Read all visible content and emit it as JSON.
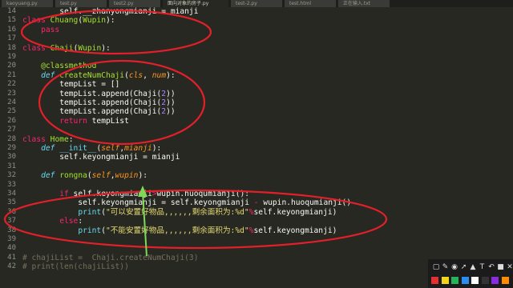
{
  "tabs": [
    {
      "label": "kaoyuang.py"
    },
    {
      "label": "test.py"
    },
    {
      "label": "test2.py"
    },
    {
      "label": "面向对象的房子.py"
    },
    {
      "label": "test-2.py"
    },
    {
      "label": "test.html"
    },
    {
      "label": "正在输入.txt"
    }
  ],
  "lines": [
    {
      "n": "14",
      "html": "        self.__zhanyongmianji = mianji"
    },
    {
      "n": "15",
      "html": "<span class='k'>class</span> <span class='f'>Chuang</span>(<span class='f'>Wupin</span>):"
    },
    {
      "n": "16",
      "html": "    <span class='k'>pass</span>"
    },
    {
      "n": "17",
      "html": ""
    },
    {
      "n": "18",
      "html": "<span class='k'>class</span> <span class='f'>Chaji</span>(<span class='f'>Wupin</span>):"
    },
    {
      "n": "19",
      "html": ""
    },
    {
      "n": "20",
      "html": "    <span class='f'>@classmethod</span>"
    },
    {
      "n": "21",
      "html": "    <span class='d'>def</span> <span class='f'>createNumChaji</span>(<span class='p'>cls</span>, <span class='p'>num</span>):"
    },
    {
      "n": "22",
      "html": "        tempList = []"
    },
    {
      "n": "23",
      "html": "        tempList.append(Chaji(<span class='n'>2</span>))"
    },
    {
      "n": "24",
      "html": "        tempList.append(Chaji(<span class='n'>2</span>))"
    },
    {
      "n": "25",
      "html": "        tempList.append(Chaji(<span class='n'>2</span>))"
    },
    {
      "n": "26",
      "html": "        <span class='k'>return</span> tempList"
    },
    {
      "n": "27",
      "html": ""
    },
    {
      "n": "28",
      "html": "<span class='k'>class</span> <span class='f'>Home</span>:"
    },
    {
      "n": "29",
      "html": "    <span class='d'>def</span> <span class='c'>__init__</span>(<span class='p'>self</span>,<span class='p'>mianji</span>):"
    },
    {
      "n": "30",
      "html": "        self.keyongmianji = mianji"
    },
    {
      "n": "31",
      "html": ""
    },
    {
      "n": "32",
      "html": "    <span class='d'>def</span> <span class='f'>rongna</span>(<span class='p'>self</span>,<span class='p'>wupin</span>):"
    },
    {
      "n": "33",
      "html": ""
    },
    {
      "n": "34",
      "html": "        <span class='k'>if</span> self.keyongmianji<span class='k'>&gt;</span>wupin.huoqumianji():"
    },
    {
      "n": "35",
      "html": "            self.keyongmianji = self.keyongmianji <span class='k'>-</span> wupin.huoqumianji()"
    },
    {
      "n": "36",
      "html": "            <span class='c'>print</span>(<span class='s'>\"可以安置好物品,,,,,,剩余面积为:%d\"</span><span class='k'>%</span>self.keyongmianji)"
    },
    {
      "n": "37",
      "html": "        <span class='k'>else</span>:"
    },
    {
      "n": "38",
      "html": "            <span class='c'>print</span>(<span class='s'>\"不能安置好物品,,,,,,剩余面积为:%d\"</span><span class='k'>%</span>self.keyongmianji)"
    },
    {
      "n": "39",
      "html": ""
    },
    {
      "n": "40",
      "html": ""
    },
    {
      "n": "41",
      "html": "<span class='cm'># chajiList =  Chaji.createNumChaji(3)</span>"
    },
    {
      "n": "42",
      "html": "<span class='cm'># print(len(chajiList))</span>"
    }
  ],
  "toolbar": {
    "buttons": [
      "▢",
      "✎",
      "◉",
      "➚",
      "▲",
      "T",
      "↶",
      "■",
      "✕"
    ],
    "swatches": [
      "#e52e2e",
      "#f2d21b",
      "#25b35a",
      "#2d8cf0",
      "#ffffff",
      "#333333",
      "#8a2be2",
      "#ff8c00"
    ]
  },
  "annotation_colors": {
    "circle": "#e3202a",
    "arrow": "#7ed957"
  }
}
